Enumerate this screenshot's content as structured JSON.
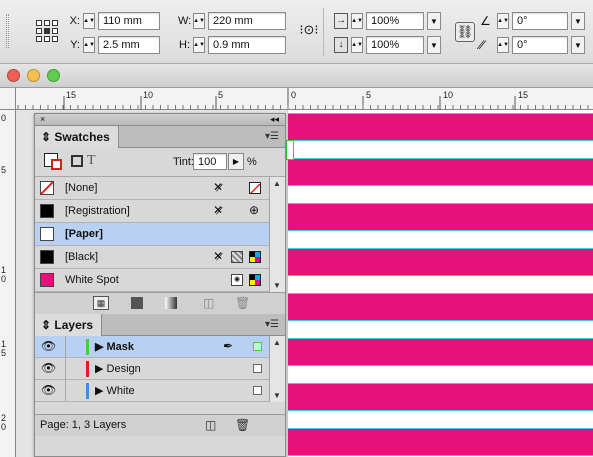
{
  "control": {
    "x_label": "X:",
    "x_value": "110 mm",
    "y_label": "Y:",
    "y_value": "2.5 mm",
    "w_label": "W:",
    "w_value": "220 mm",
    "h_label": "H:",
    "h_value": "0.9 mm",
    "scale_x": "100%",
    "scale_y": "100%",
    "rotate": "0°",
    "shear": "0°"
  },
  "ruler": {
    "h_labels": [
      "15",
      "10",
      "5",
      "0",
      "5",
      "10",
      "15"
    ],
    "v_labels": [
      "0",
      "5",
      "10",
      "15",
      "20"
    ]
  },
  "swatches": {
    "tab_label": "Swatches",
    "tint_label": "Tint:",
    "tint_value": "100",
    "tint_unit": "%",
    "items": [
      {
        "name": "[None]",
        "color": "none"
      },
      {
        "name": "[Registration]",
        "color": "#000000"
      },
      {
        "name": "[Paper]",
        "color": "#ffffff"
      },
      {
        "name": "[Black]",
        "color": "#000000"
      },
      {
        "name": "White Spot",
        "color": "#e5127a"
      }
    ]
  },
  "layers": {
    "tab_label": "Layers",
    "items": [
      {
        "name": "Mask",
        "color": "#3fd13f"
      },
      {
        "name": "Design",
        "color": "#e02020"
      },
      {
        "name": "White",
        "color": "#3a8ee6"
      }
    ],
    "status": "Page: 1, 3 Layers"
  },
  "colors": {
    "accent_magenta": "#e5127a",
    "selection_blue": "#b8d1f3"
  }
}
